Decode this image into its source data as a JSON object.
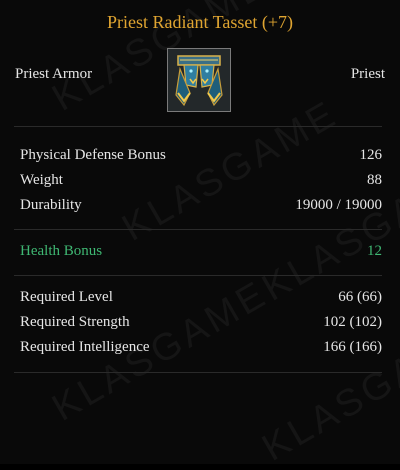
{
  "item": {
    "name": "Priest Radiant Tasset (+7)",
    "category": "Priest Armor",
    "class": "Priest",
    "icon": "tasset-armor-icon"
  },
  "stats": [
    {
      "label": "Physical Defense Bonus",
      "value": "126"
    },
    {
      "label": "Weight",
      "value": "88"
    },
    {
      "label": "Durability",
      "value": "19000 / 19000"
    }
  ],
  "bonuses": [
    {
      "label": "Health Bonus",
      "value": "12"
    }
  ],
  "requirements": [
    {
      "label": "Required Level",
      "value": "66 (66)"
    },
    {
      "label": "Required Strength",
      "value": "102 (102)"
    },
    {
      "label": "Required Intelligence",
      "value": "166 (166)"
    }
  ],
  "watermark": "KLASGAME",
  "colors": {
    "title": "#e0a531",
    "bonus": "#3fb873",
    "text": "#e6e6e6",
    "background": "#090909"
  }
}
